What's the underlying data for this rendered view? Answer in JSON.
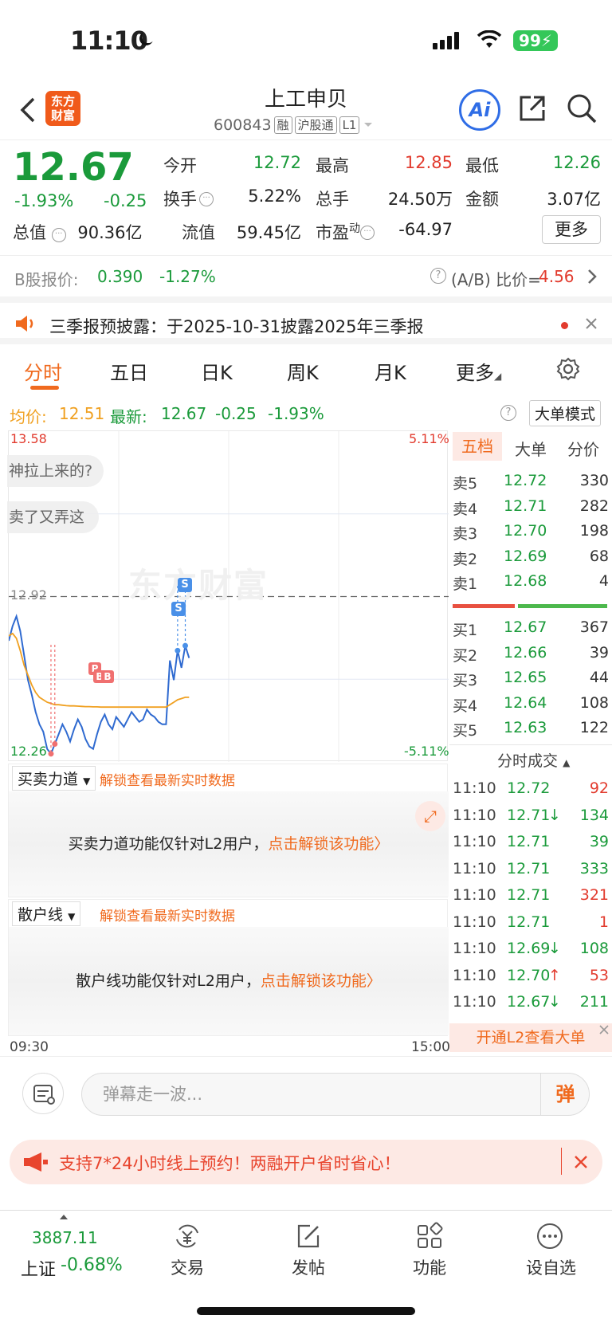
{
  "status_bar": {
    "time": "11:10",
    "battery": "99"
  },
  "header": {
    "logo_text_1": "东方",
    "logo_text_2": "财富",
    "stock_name": "上工申贝",
    "stock_code": "600843",
    "tags": [
      "融",
      "沪股通",
      "L1"
    ],
    "ai_label": "Ai"
  },
  "quote": {
    "price": "12.67",
    "change_pct": "-1.93%",
    "change": "-0.25",
    "total_value_label": "总值",
    "total_value": "90.36亿",
    "open_label": "今开",
    "open": "12.72",
    "high_label": "最高",
    "high": "12.85",
    "low_label": "最低",
    "low": "12.26",
    "turnover_label": "换手",
    "turnover": "5.22%",
    "volume_label": "总手",
    "volume": "24.50万",
    "amount_label": "金额",
    "amount": "3.07亿",
    "float_label": "流值",
    "float_value": "59.45亿",
    "pe_label": "市盈",
    "pe_super": "动",
    "pe": "-64.97",
    "more_button": "更多"
  },
  "b_share": {
    "label": "B股报价:",
    "price": "0.390",
    "pct": "-1.27%",
    "ratio_label": "(A/B) 比价=",
    "ratio": "4.56"
  },
  "notice": {
    "text": "三季报预披露：于2025-10-31披露2025年三季报"
  },
  "tabs": [
    "分时",
    "五日",
    "日K",
    "周K",
    "月K",
    "更多"
  ],
  "price_line": {
    "avg_label": "均价:",
    "avg": "12.51",
    "latest_label": "最新:",
    "latest": "12.67",
    "change": "-0.25",
    "pct": "-1.93%",
    "mode_button": "大单模式"
  },
  "chart": {
    "max_price": "13.58",
    "min_price": "12.26",
    "max_pct": "5.11%",
    "min_pct": "-5.11%",
    "ref_price": "12.92",
    "start_time": "09:30",
    "end_time": "15:00",
    "watermark": "东方财富",
    "bubble_1": "神拉上来的?",
    "bubble_2": "卖了又弄这",
    "marker_s": "S",
    "marker_b": "B",
    "marker_p": "P"
  },
  "chart_data": {
    "type": "line",
    "x_range": [
      "09:30",
      "15:00"
    ],
    "ylim": [
      12.26,
      13.58
    ],
    "series": [
      {
        "values": [
          12.74,
          12.8,
          12.84,
          12.78,
          12.68,
          12.58,
          12.52,
          12.45,
          12.4,
          12.37,
          12.3,
          12.28,
          12.32,
          12.36,
          12.4,
          12.37,
          12.33,
          12.38,
          12.42,
          12.39,
          12.34,
          12.31,
          12.3,
          12.36,
          12.41,
          12.44,
          12.4,
          12.38,
          12.43,
          12.41,
          12.39,
          12.42,
          12.45,
          12.43,
          12.41,
          12.42,
          12.46,
          12.44,
          12.43,
          12.41,
          12.4,
          12.4,
          12.66,
          12.58,
          12.7,
          12.63,
          12.72,
          12.67
        ]
      },
      {
        "values": [
          12.76,
          12.77,
          12.75,
          12.7,
          12.64,
          12.6,
          12.56,
          12.53,
          12.51,
          12.5,
          12.49,
          12.485,
          12.48,
          12.48,
          12.478,
          12.476,
          12.475,
          12.475,
          12.474,
          12.473,
          12.472,
          12.472,
          12.471,
          12.471,
          12.47,
          12.47,
          12.47,
          12.47,
          12.47,
          12.47,
          12.47,
          12.47,
          12.47,
          12.47,
          12.47,
          12.47,
          12.47,
          12.47,
          12.47,
          12.47,
          12.47,
          12.47,
          12.48,
          12.49,
          12.5,
          12.505,
          12.51,
          12.51
        ]
      }
    ]
  },
  "order_book": {
    "tabs": [
      "五档",
      "大单",
      "分价"
    ],
    "asks": [
      {
        "label": "卖5",
        "price": "12.72",
        "vol": "330"
      },
      {
        "label": "卖4",
        "price": "12.71",
        "vol": "282"
      },
      {
        "label": "卖3",
        "price": "12.70",
        "vol": "198"
      },
      {
        "label": "卖2",
        "price": "12.69",
        "vol": "68"
      },
      {
        "label": "卖1",
        "price": "12.68",
        "vol": "4"
      }
    ],
    "bids": [
      {
        "label": "买1",
        "price": "12.67",
        "vol": "367"
      },
      {
        "label": "买2",
        "price": "12.66",
        "vol": "39"
      },
      {
        "label": "买3",
        "price": "12.65",
        "vol": "44"
      },
      {
        "label": "买4",
        "price": "12.64",
        "vol": "108"
      },
      {
        "label": "买5",
        "price": "12.63",
        "vol": "122"
      }
    ],
    "trades_title": "分时成交",
    "trades": [
      {
        "time": "11:10",
        "price": "12.72",
        "arrow": "",
        "vol": "92",
        "color": "red"
      },
      {
        "time": "11:10",
        "price": "12.71",
        "arrow": "↓",
        "vol": "134",
        "color": "green"
      },
      {
        "time": "11:10",
        "price": "12.71",
        "arrow": "",
        "vol": "39",
        "color": "green"
      },
      {
        "time": "11:10",
        "price": "12.71",
        "arrow": "",
        "vol": "333",
        "color": "green"
      },
      {
        "time": "11:10",
        "price": "12.71",
        "arrow": "",
        "vol": "321",
        "color": "red"
      },
      {
        "time": "11:10",
        "price": "12.71",
        "arrow": "",
        "vol": "1",
        "color": "red"
      },
      {
        "time": "11:10",
        "price": "12.69",
        "arrow": "↓",
        "vol": "108",
        "color": "green"
      },
      {
        "time": "11:10",
        "price": "12.70",
        "arrow": "↑",
        "vol": "53",
        "color": "red"
      },
      {
        "time": "11:10",
        "price": "12.67",
        "arrow": "↓",
        "vol": "211",
        "color": "green"
      }
    ],
    "l2_banner": "开通L2查看大单"
  },
  "panel1": {
    "dropdown": "买卖力道",
    "unlock": "解锁查看最新实时数据",
    "body": "买卖力道功能仅针对L2用户，",
    "link": "点击解锁该功能"
  },
  "panel2": {
    "dropdown": "散户线",
    "unlock": "解锁查看最新实时数据",
    "body": "散户线功能仅针对L2用户，",
    "link": "点击解锁该功能"
  },
  "comment": {
    "placeholder": "弹幕走一波...",
    "send_label": "弹"
  },
  "promo": {
    "text": "支持7*24小时线上预约！两融开户省时省心！"
  },
  "bottom_nav": {
    "index_value": "3887.11",
    "index_name": "上证",
    "index_pct": "-0.68%",
    "items": [
      "交易",
      "发帖",
      "功能",
      "设自选"
    ]
  },
  "colors": {
    "up": "#e23b2e",
    "down": "#1a9a3a",
    "accent": "#f06a1e",
    "avg_line": "#f0a020",
    "price_line": "#2f6ad0"
  }
}
